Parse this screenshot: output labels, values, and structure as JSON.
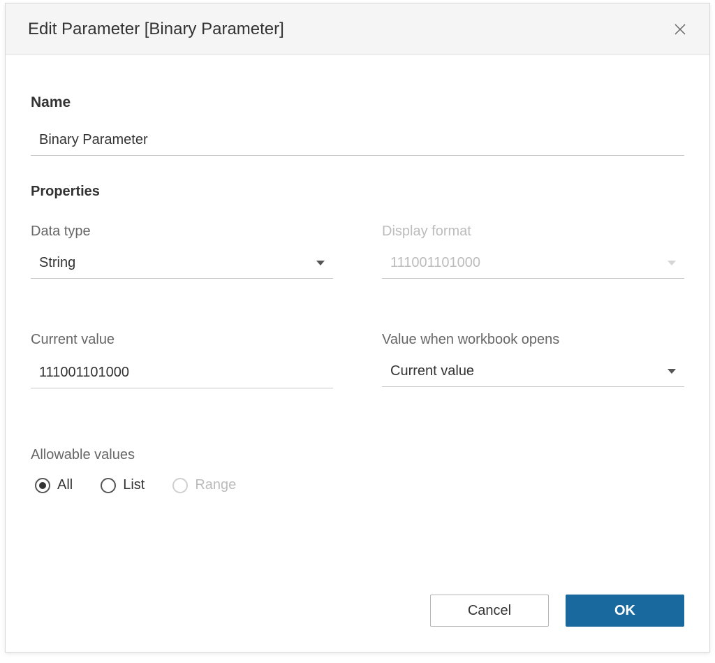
{
  "dialog": {
    "title": "Edit Parameter [Binary Parameter]"
  },
  "name": {
    "heading": "Name",
    "value": "Binary Parameter"
  },
  "properties": {
    "heading": "Properties",
    "data_type": {
      "label": "Data type",
      "value": "String"
    },
    "display_format": {
      "label": "Display format",
      "value": "111001101000",
      "disabled": true
    },
    "current_value": {
      "label": "Current value",
      "value": "111001101000"
    },
    "value_on_open": {
      "label": "Value when workbook opens",
      "value": "Current value"
    }
  },
  "allowable": {
    "label": "Allowable values",
    "options": {
      "all": "All",
      "list": "List",
      "range": "Range"
    },
    "selected": "all",
    "range_disabled": true
  },
  "buttons": {
    "cancel": "Cancel",
    "ok": "OK"
  }
}
